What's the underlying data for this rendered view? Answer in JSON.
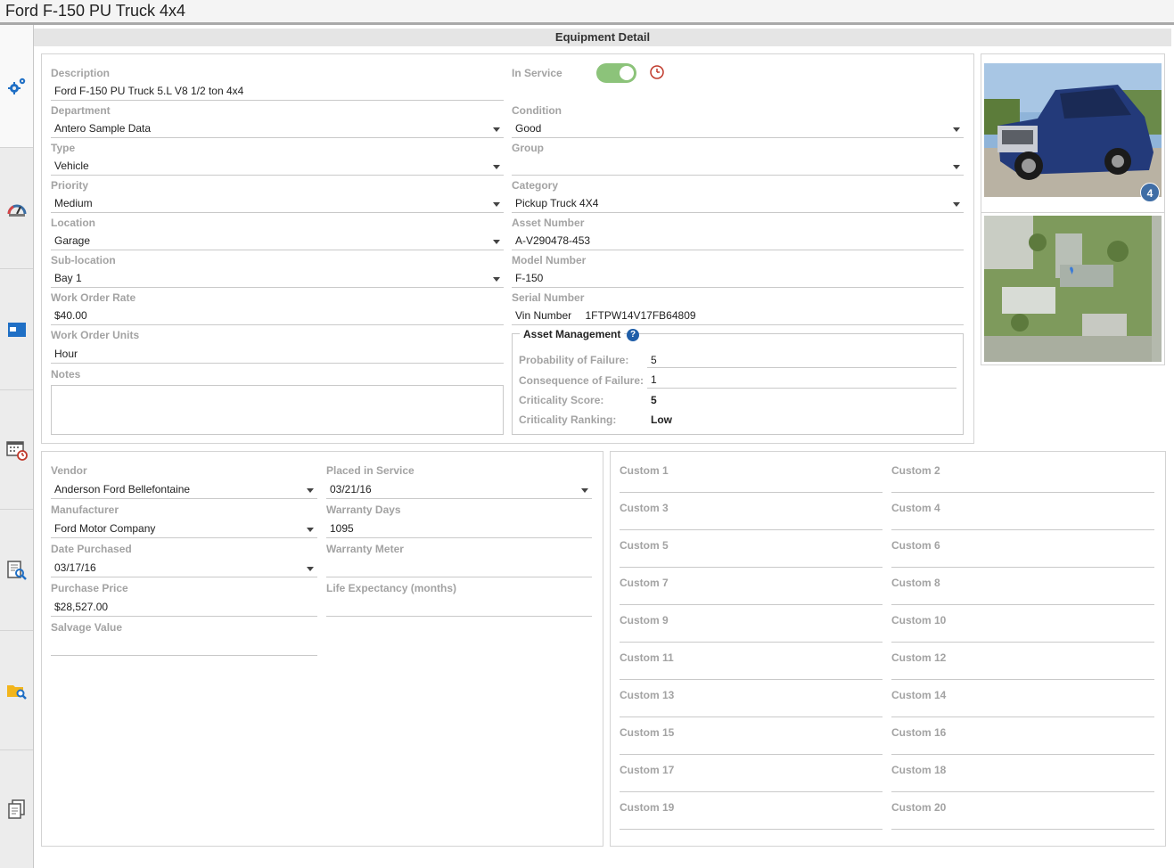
{
  "window": {
    "title": "Ford F-150 PU Truck 4x4"
  },
  "section": {
    "title": "Equipment Detail"
  },
  "sidebar": {
    "items": [
      {
        "icon": "gears-icon",
        "active": true
      },
      {
        "icon": "gauge-icon",
        "active": false
      },
      {
        "icon": "window-icon",
        "active": false
      },
      {
        "icon": "calendar-clock-icon",
        "active": false
      },
      {
        "icon": "document-search-icon",
        "active": false
      },
      {
        "icon": "folder-search-icon",
        "active": false
      },
      {
        "icon": "copy-document-icon",
        "active": false
      }
    ]
  },
  "colors": {
    "toggle_on": "#8cc37a",
    "clock_red": "#c0392b",
    "badge_blue": "#3f6da5",
    "label_gray": "#a3a3a3"
  },
  "detail": {
    "description": {
      "label": "Description",
      "value": "Ford F-150 PU Truck 5.L  V8 1/2 ton 4x4"
    },
    "in_service": {
      "label": "In Service",
      "on": true
    },
    "department": {
      "label": "Department",
      "value": "Antero Sample Data"
    },
    "condition": {
      "label": "Condition",
      "value": "Good"
    },
    "type": {
      "label": "Type",
      "value": "Vehicle"
    },
    "group": {
      "label": "Group",
      "value": ""
    },
    "priority": {
      "label": "Priority",
      "value": "Medium"
    },
    "category": {
      "label": "Category",
      "value": "Pickup Truck 4X4"
    },
    "location": {
      "label": "Location",
      "value": "Garage"
    },
    "asset_number": {
      "label": "Asset Number",
      "value": "A-V290478-453"
    },
    "sub_location": {
      "label": "Sub-location",
      "value": "Bay 1"
    },
    "model_number": {
      "label": "Model Number",
      "value": "F-150"
    },
    "work_order_rate": {
      "label": "Work Order Rate",
      "value": "$40.00"
    },
    "serial_number": {
      "label": "Serial Number",
      "prefix": "Vin Number",
      "value": "1FTPW14V17FB64809"
    },
    "work_order_units": {
      "label": "Work Order Units",
      "value": "Hour"
    },
    "notes": {
      "label": "Notes",
      "value": ""
    }
  },
  "asset_management": {
    "title": "Asset Management",
    "help": "?",
    "probability_of_failure": {
      "label": "Probability of Failure:",
      "value": "5"
    },
    "consequence_of_failure": {
      "label": "Consequence of Failure:",
      "value": "1"
    },
    "criticality_score": {
      "label": "Criticality Score:",
      "value": "5"
    },
    "criticality_ranking": {
      "label": "Criticality Ranking:",
      "value": "Low"
    }
  },
  "photos": {
    "count": "4"
  },
  "purchase": {
    "vendor": {
      "label": "Vendor",
      "value": "Anderson Ford Bellefontaine"
    },
    "placed_in_service": {
      "label": "Placed in Service",
      "value": "03/21/16"
    },
    "manufacturer": {
      "label": "Manufacturer",
      "value": "Ford Motor Company"
    },
    "warranty_days": {
      "label": "Warranty Days",
      "value": "1095"
    },
    "date_purchased": {
      "label": "Date Purchased",
      "value": "03/17/16"
    },
    "warranty_meter": {
      "label": "Warranty Meter",
      "value": ""
    },
    "purchase_price": {
      "label": "Purchase Price",
      "value": "$28,527.00"
    },
    "life_expectancy": {
      "label": "Life Expectancy (months)",
      "value": ""
    },
    "salvage_value": {
      "label": "Salvage Value",
      "value": ""
    }
  },
  "custom": [
    {
      "label": "Custom 1",
      "value": ""
    },
    {
      "label": "Custom 2",
      "value": ""
    },
    {
      "label": "Custom 3",
      "value": ""
    },
    {
      "label": "Custom 4",
      "value": ""
    },
    {
      "label": "Custom 5",
      "value": ""
    },
    {
      "label": "Custom 6",
      "value": ""
    },
    {
      "label": "Custom 7",
      "value": ""
    },
    {
      "label": "Custom 8",
      "value": ""
    },
    {
      "label": "Custom 9",
      "value": ""
    },
    {
      "label": "Custom 10",
      "value": ""
    },
    {
      "label": "Custom 11",
      "value": ""
    },
    {
      "label": "Custom 12",
      "value": ""
    },
    {
      "label": "Custom 13",
      "value": ""
    },
    {
      "label": "Custom 14",
      "value": ""
    },
    {
      "label": "Custom 15",
      "value": ""
    },
    {
      "label": "Custom 16",
      "value": ""
    },
    {
      "label": "Custom 17",
      "value": ""
    },
    {
      "label": "Custom 18",
      "value": ""
    },
    {
      "label": "Custom 19",
      "value": ""
    },
    {
      "label": "Custom 20",
      "value": ""
    }
  ]
}
